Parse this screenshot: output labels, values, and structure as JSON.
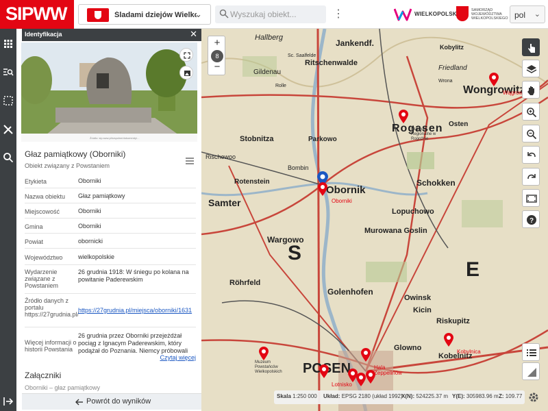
{
  "header": {
    "logo_text": "SIPWW",
    "project_name": "Śladami dziejów Wielkopolski",
    "search_placeholder": "Wyszukaj obiekt...",
    "brand_name": "WIELKOPOLSKA",
    "samorzad_text": "SAMORZĄD WOJEWÓDZTWA WIELKOPOLSKIEGO",
    "language": "pol"
  },
  "panel": {
    "header_title": "Identyfikacja",
    "photo_caption": "Źródło: sip.sww.pl/wspolne/dokumenty/...",
    "object_title": "Głaz pamiątkowy (Oborniki)",
    "object_subtitle": "Obiekt związany z Powstaniem",
    "rows": [
      {
        "key": "Etykieta",
        "value": "Oborniki"
      },
      {
        "key": "Nazwa obiektu",
        "value": "Głaz pamiątkowy"
      },
      {
        "key": "Miejscowość",
        "value": "Oborniki"
      },
      {
        "key": "Gmina",
        "value": "Oborniki"
      },
      {
        "key": "Powiat",
        "value": "obornicki"
      },
      {
        "key": "Województwo",
        "value": "wielkopolskie"
      },
      {
        "key": "Wydarzenie związane z Powstaniem",
        "value": "26 grudnia 1918: W śniegu po kolana na powitanie Paderewskim"
      },
      {
        "key": "Źródło danych z portalu https://27grudnia.pl/",
        "value": "https://27grudnia.pl/miejsca/oborniki/1631"
      },
      {
        "key": "Więcej informacji o historii Powstania",
        "value": "26 grudnia przez Oborniki przejeżdżał pociąg z Ignacym Paderewskim, który podążał do Poznania. Niemcy próbowali z..."
      }
    ],
    "read_more": "Czytaj więcej",
    "attachments_title": "Załączniki",
    "attachment_item": "Oborniki – głaz pamiątkowy",
    "back_button": "Powrót do wyników"
  },
  "map": {
    "zoom_level": "8",
    "zoom_in": "+",
    "zoom_out": "−",
    "labels": [
      "Hallberg",
      "Jankendf.",
      "Kobylitz",
      "Sc. Saalfelde",
      "Ritschenwalde",
      "Gildenau",
      "Rolle",
      "Wrona",
      "Friedland",
      "Stobnitza",
      "Parkowo",
      "Rogasen",
      "Osten",
      "Wongrowitz",
      "Rischewoo",
      "Bombin",
      "Rotenstein",
      "Obornik",
      "Schokken",
      "Samter",
      "Wargowo",
      "Lopuchowo",
      "Murowana Goslin",
      "Röhrfeld",
      "Golenhofen",
      "Owinsk",
      "Kicin",
      "Riskupitz",
      "Kobelnitz",
      "Glowno",
      "POSEN"
    ],
    "pin_labels": [
      "Wągrowiec",
      "Muzeum Regionalne w Rogoźnie",
      "Oborniki",
      "Kobylnica",
      "Muzeum Powstańców Wielkopolskich",
      "Hala Zeppelinów",
      "Lotnisko"
    ],
    "region_letters": [
      "S",
      "E"
    ]
  },
  "status": {
    "scale_label": "Skala",
    "scale_value": "1:250 000",
    "crs_label": "Układ:",
    "crs_value": "EPSG 2180 (układ 1992)",
    "x_label": "X(N):",
    "x_value": "524225.37 m",
    "y_label": "Y(E):",
    "y_value": "305983.96 m",
    "z_label": "Z:",
    "z_value": "109.77"
  },
  "colors": {
    "brand_red": "#e30613",
    "dark_bar": "#3c4043",
    "link_blue": "#1a57c2",
    "map_bg": "#e7dfc6",
    "road_red": "#c8463b"
  }
}
